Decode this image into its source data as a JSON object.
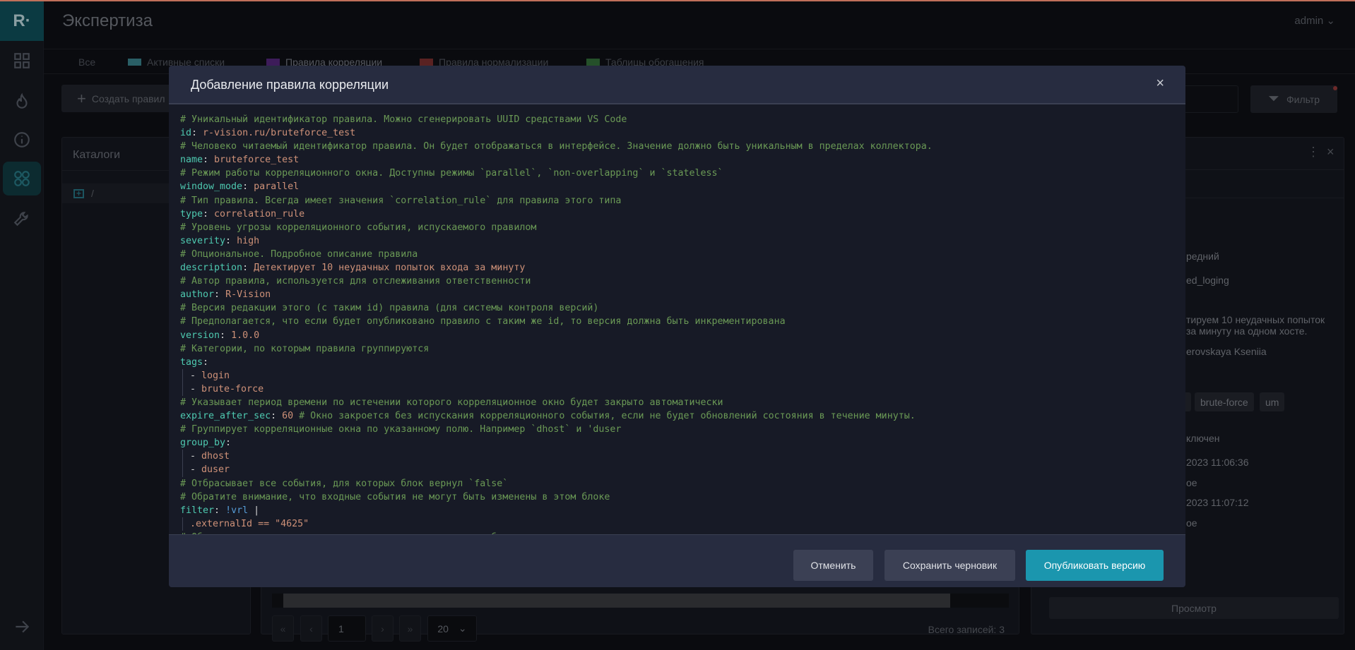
{
  "app": {
    "logo": "R·",
    "title": "Экспертиза",
    "user": "admin"
  },
  "sidebar": {
    "items": [
      {
        "icon": "dashboard-icon"
      },
      {
        "icon": "fire-icon"
      },
      {
        "icon": "info-icon"
      },
      {
        "icon": "expertise-icon",
        "active": true
      },
      {
        "icon": "wrench-icon"
      },
      {
        "icon": "arrow-right-icon"
      }
    ]
  },
  "tabs": [
    {
      "label": "Все"
    },
    {
      "label": "Активные списки",
      "color": "#2a5f66"
    },
    {
      "label": "Правила корреляции",
      "color": "#3d1c5a",
      "active": true
    },
    {
      "label": "Правила нормализации",
      "color": "#5a2222"
    },
    {
      "label": "Таблицы обогащения",
      "color": "#25502a"
    }
  ],
  "toolbar": {
    "create_label": "Создать правил",
    "filter_label": "Фильтр"
  },
  "catalogs": {
    "title": "Каталоги",
    "root": "/"
  },
  "pagination": {
    "page": "1",
    "page_size": "20",
    "total": "Всего записей: 3"
  },
  "details": {
    "lines": [
      "редний",
      "ed_loging",
      "тируем 10 неудачных попыток",
      "за минуту на одном хосте.",
      "erovskaya Kseniia",
      "ключен",
      "2023 11:06:36",
      "ое",
      "2023 11:07:12",
      "ое"
    ],
    "tags": [
      "brute-force",
      "um"
    ],
    "view_label": "Просмотр"
  },
  "modal": {
    "title": "Добавление правила корреляции",
    "close": "×",
    "buttons": {
      "cancel": "Отменить",
      "save_draft": "Сохранить черновик",
      "publish": "Опубликовать версию"
    },
    "colors": {
      "comment": "#6a9955",
      "key": "#4ec9b0",
      "value": "#ce9178",
      "tag": "#569cd6",
      "publish": "#1b96ae"
    },
    "code": [
      {
        "t": [
          [
            "c",
            "# Уникальный идентификатор правила. Можно сгенерировать UUID средствами VS Code"
          ]
        ]
      },
      {
        "t": [
          [
            "k",
            "id"
          ],
          [
            "p",
            ": "
          ],
          [
            "v",
            "r-vision.ru/bruteforce_test"
          ]
        ]
      },
      {
        "t": [
          [
            "c",
            "# Человеко читаемый идентификатор правила. Он будет отображаться в интерфейсе. Значение должно быть уникальным в пределах коллектора."
          ]
        ]
      },
      {
        "t": [
          [
            "k",
            "name"
          ],
          [
            "p",
            ": "
          ],
          [
            "v",
            "bruteforce_test"
          ]
        ]
      },
      {
        "t": [
          [
            "c",
            "# Режим работы корреляционного окна. Доступны режимы `parallel`, `non-overlapping` и `stateless`"
          ]
        ]
      },
      {
        "t": [
          [
            "k",
            "window_mode"
          ],
          [
            "p",
            ": "
          ],
          [
            "v",
            "parallel"
          ]
        ]
      },
      {
        "t": [
          [
            "c",
            "# Тип правила. Всегда имеет значения `correlation_rule` для правила этого типа"
          ]
        ]
      },
      {
        "t": [
          [
            "k",
            "type"
          ],
          [
            "p",
            ": "
          ],
          [
            "v",
            "correlation_rule"
          ]
        ]
      },
      {
        "t": [
          [
            "c",
            "# Уровень угрозы корреляционного события, испускаемого правилом"
          ]
        ]
      },
      {
        "t": [
          [
            "k",
            "severity"
          ],
          [
            "p",
            ": "
          ],
          [
            "v",
            "high"
          ]
        ]
      },
      {
        "t": [
          [
            "c",
            "# Опциональное. Подробное описание правила"
          ]
        ]
      },
      {
        "t": [
          [
            "k",
            "description"
          ],
          [
            "p",
            ": "
          ],
          [
            "v",
            "Детектирует 10 неудачных попыток входа за минуту"
          ]
        ]
      },
      {
        "t": [
          [
            "c",
            "# Автор правила, используется для отслеживания ответственности"
          ]
        ]
      },
      {
        "t": [
          [
            "k",
            "author"
          ],
          [
            "p",
            ": "
          ],
          [
            "v",
            "R-Vision"
          ]
        ]
      },
      {
        "t": [
          [
            "c",
            "# Версия редакции этого (с таким id) правила (для системы контроля версий)"
          ]
        ]
      },
      {
        "t": [
          [
            "c",
            "# Предполагается, что если будет опубликовано правило с таким же id, то версия должна быть инкрементирована"
          ]
        ]
      },
      {
        "t": [
          [
            "k",
            "version"
          ],
          [
            "p",
            ": "
          ],
          [
            "v",
            "1.0.0"
          ]
        ]
      },
      {
        "t": [
          [
            "c",
            "# Категории, по которым правила группируются"
          ]
        ]
      },
      {
        "t": [
          [
            "k",
            "tags"
          ],
          [
            "p",
            ":"
          ]
        ]
      },
      {
        "indent": true,
        "t": [
          [
            "p",
            "- "
          ],
          [
            "v",
            "login"
          ]
        ]
      },
      {
        "indent": true,
        "t": [
          [
            "p",
            "- "
          ],
          [
            "v",
            "brute-force"
          ]
        ]
      },
      {
        "t": [
          [
            "c",
            "# Указывает период времени по истечении которого корреляционное окно будет закрыто автоматически"
          ]
        ]
      },
      {
        "t": [
          [
            "k",
            "expire_after_sec"
          ],
          [
            "p",
            ": "
          ],
          [
            "v",
            "60"
          ],
          [
            "c",
            " # Окно закроется без испускания корреляционного события, если не будет обновлений состояния в течение минуты."
          ]
        ]
      },
      {
        "t": [
          [
            "c",
            "# Группирует корреляционные окна по указанному полю. Например `dhost` и 'duser"
          ]
        ]
      },
      {
        "t": [
          [
            "k",
            "group_by"
          ],
          [
            "p",
            ":"
          ]
        ]
      },
      {
        "indent": true,
        "t": [
          [
            "p",
            "- "
          ],
          [
            "v",
            "dhost"
          ]
        ]
      },
      {
        "indent": true,
        "t": [
          [
            "p",
            "- "
          ],
          [
            "v",
            "duser"
          ]
        ]
      },
      {
        "t": [
          [
            "c",
            "# Отбрасывает все события, для которых блок вернул `false`"
          ]
        ]
      },
      {
        "t": [
          [
            "c",
            "# Обратите внимание, что входные события не могут быть изменены в этом блоке"
          ]
        ]
      },
      {
        "t": [
          [
            "k",
            "filter"
          ],
          [
            "p",
            ": "
          ],
          [
            "b",
            "!vrl"
          ],
          [
            "p",
            " |"
          ]
        ]
      },
      {
        "indent": true,
        "t": [
          [
            "v",
            ".externalId == \"4625\""
          ]
        ]
      },
      {
        "t": [
          [
            "c",
            "# Объединяет корреляционные окна при помощи входного события"
          ]
        ]
      }
    ]
  }
}
